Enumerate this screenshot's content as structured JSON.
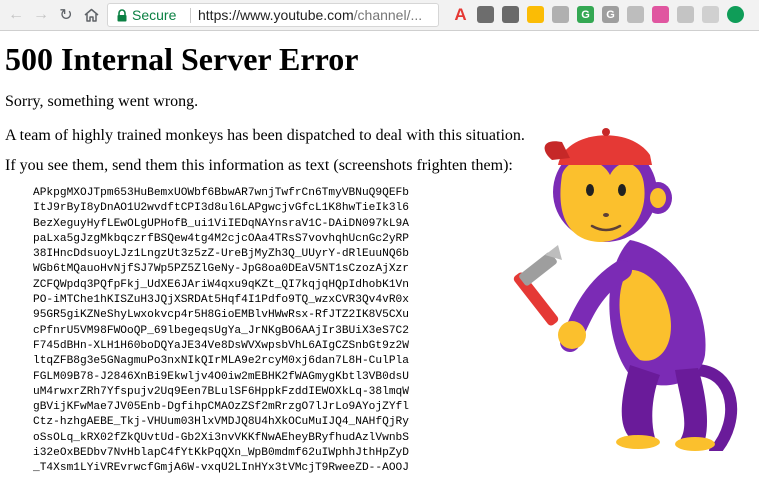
{
  "browser": {
    "secure_label": "Secure",
    "url_host": "https://www.youtube.com",
    "url_path": "/channel/...",
    "extensions": [
      {
        "label": "A",
        "color": "#e53935"
      },
      {
        "label": "",
        "color": "#6d6d6d"
      },
      {
        "label": "",
        "color": "#6a6a6a"
      },
      {
        "label": "",
        "color": "#fbbc05"
      },
      {
        "label": "",
        "color": "#b0b0b0"
      },
      {
        "label": "G",
        "color": "#34a853"
      },
      {
        "label": "G",
        "color": "#9e9e9e"
      },
      {
        "label": "",
        "color": "#bdbdbd"
      },
      {
        "label": "",
        "color": "#e056a0"
      },
      {
        "label": "",
        "color": "#c4c4c4"
      },
      {
        "label": "",
        "color": "#d0d0d0"
      },
      {
        "label": "",
        "color": "#0f9d58"
      }
    ]
  },
  "page": {
    "title": "500 Internal Server Error",
    "line1": "Sorry, something went wrong.",
    "line2": "A team of highly trained monkeys has been dispatched to deal with this situation.",
    "line3": "If you see them, send them this information as text (screenshots frighten them):",
    "error_lines": [
      "APkpgMXOJTpm653HuBemxUOWbf6BbwAR7wnjTwfrCn6TmyVBNuQ9QEFb",
      "ItJ9rByI8yDnAO1U2wvdftCPI3d8ul6LAPgwcjvGfcL1K8hwTieIk3l6",
      "BezXeguyHyfLEwOLgUPHofB_ui1ViIEDqNAYnsraV1C-DAiDN097kL9A",
      "paLxa5gJzgMkbqczrfBSQew4tg4M2cjcOAa4TRsS7vovhqhUcnGc2yRP",
      "38IHncDdsuoyLJz1LngzUt3z5zZ-UreBjMyZh3Q_UUyrY-dRlEuuNQ6b",
      "WGb6tMQauoHvNjfSJ7Wp5PZ5ZlGeNy-JpG8oa0DEaV5NT1sCzozAjXzr",
      "ZCFQWpdq3PQfpFkj_UdXE6JAriW4qxu9qKZt_QI7kqjqHQpIdhobK1Vn",
      "PO-iMTChe1hKISZuH3JQjXSRDAt5Hqf4I1Pdfo9TQ_wzxCVR3Qv4vR0x",
      "95GR5giKZNeShyLwxokvcp4r5H8GioEMBlvHWwRsx-RfJTZ2IK8V5CXu",
      "cPfnrU5VM98FWOoQP_69lbegeqsUgYa_JrNKgBO6AAjIr3BUiX3eS7C2",
      "F745dBHn-XLH1H60boDQYaJE34Ve8DsWVXwpsbVhL6AIgCZSnbGt9z2W",
      "ltqZFB8g3e5GNagmuPo3nxNIkQIrMLA9e2rcyM0xj6dan7L8H-CulPla",
      "FGLM09B78-J2846XnBi9Ekwljv4O0iw2mEBHK2fWAGmygKbtl3VB0dsU",
      "uM4rwxrZRh7Yfspujv2Uq9Een7BLulSF6HppkFzddIEWOXkLq-38lmqW",
      "gBVijKFwMae7JV05Enb-DgfihpCMAOzZSf2mRrzgO7lJrLo9AYojZYfl",
      "Ctz-hzhgAEBE_Tkj-VHUum03HlxVMDJQ8U4hXkOCuMuIJQ4_NAHfQjRy",
      "oSsOLq_kRX02fZkQUvtUd-Gb2Xi3nvVKKfNwAEheyBRyfhudAzlVwnbS",
      "i32eOxBEDbv7NvHblapC4fYtKkPqQXn_WpB0mdmf62uIWphhJthHpZyD",
      "_T4Xsm1LYiVREvrwcfGmjA6W-vxqU2LInHYx3tVMcjT9RweeZD--AOOJ"
    ]
  }
}
